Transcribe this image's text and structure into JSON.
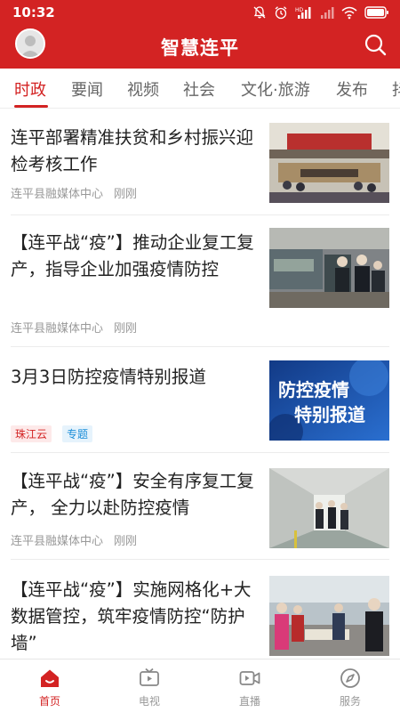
{
  "status_bar": {
    "time": "10:32"
  },
  "header": {
    "title": "智慧连平"
  },
  "colors": {
    "brand": "#d32323",
    "tag_blue": "#1c8ed8"
  },
  "tabs": [
    {
      "label": "时政",
      "active": true
    },
    {
      "label": "要闻"
    },
    {
      "label": "视频"
    },
    {
      "label": "社会"
    },
    {
      "label": "文化·旅游"
    },
    {
      "label": "发布"
    },
    {
      "label": "抖"
    }
  ],
  "feed": [
    {
      "title": "连平部署精准扶贫和乡村振兴迎检考核工作",
      "source": "连平县融媒体中心",
      "time": "刚刚"
    },
    {
      "title": "【连平战“疫”】推动企业复工复产，指导企业加强疫情防控",
      "source": "连平县融媒体中心",
      "time": "刚刚"
    },
    {
      "title": "3月3日防控疫情特别报道",
      "tags": [
        "珠江云",
        "专题"
      ],
      "thumb_text": [
        "防控疫情",
        "特别报道"
      ]
    },
    {
      "title": "【连平战“疫”】安全有序复工复产， 全力以赴防控疫情",
      "source": "连平县融媒体中心",
      "time": "刚刚"
    },
    {
      "title": "【连平战“疫”】实施网格化+大数据管控，筑牢疫情防控“防护墙”"
    }
  ],
  "bottom_nav": [
    {
      "label": "首页",
      "icon": "home-icon",
      "active": true
    },
    {
      "label": "电视",
      "icon": "tv-icon"
    },
    {
      "label": "直播",
      "icon": "live-camera-icon"
    },
    {
      "label": "服务",
      "icon": "compass-icon"
    }
  ]
}
